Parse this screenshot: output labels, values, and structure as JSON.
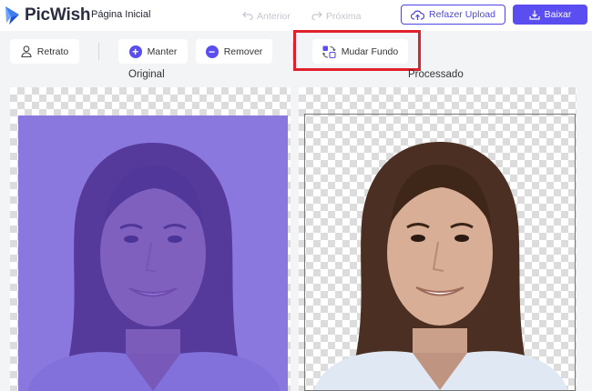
{
  "header": {
    "brand": "PicWish",
    "home_link": "Página Inicial",
    "undo_label": "Anterior",
    "redo_label": "Próxima",
    "reupload_label": "Refazer Upload",
    "download_label": "Baixar"
  },
  "toolbar": {
    "portrait_label": "Retrato",
    "keep_label": "Manter",
    "remove_label": "Remover",
    "change_bg_label": "Mudar Fundo"
  },
  "panels": {
    "original_label": "Original",
    "processed_label": "Processado"
  },
  "colors": {
    "accent": "#5b4ef0",
    "highlight": "#e0202a",
    "keep_overlay": "#5a3fd0"
  },
  "icons": [
    "picwish-logo-icon",
    "undo-icon",
    "redo-icon",
    "cloud-upload-icon",
    "download-icon",
    "person-icon",
    "plus-icon",
    "minus-icon",
    "change-background-icon"
  ]
}
